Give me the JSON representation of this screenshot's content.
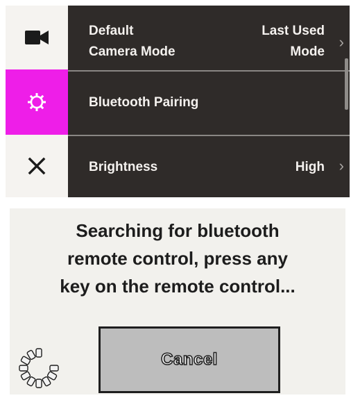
{
  "settings": {
    "items": [
      {
        "icon": "video-camera-icon",
        "label_line1": "Default",
        "label_line2": "Camera Mode",
        "value_line1": "Last Used",
        "value_line2": "Mode",
        "chevron": "›",
        "selected": false
      },
      {
        "icon": "gear-icon",
        "label": "Bluetooth Pairing",
        "selected": true
      },
      {
        "icon": "close-icon",
        "label": "Brightness",
        "value": "High",
        "chevron": "›",
        "selected": false
      }
    ],
    "accent_color": "#ee1ee8",
    "panel_color": "#2f2b29"
  },
  "dialog": {
    "message_line1": "Searching for bluetooth",
    "message_line2": "remote control, press any",
    "message_line3": "key on the remote control...",
    "cancel_label": "Cancel",
    "spinner_icon": "loading-spinner-icon"
  }
}
